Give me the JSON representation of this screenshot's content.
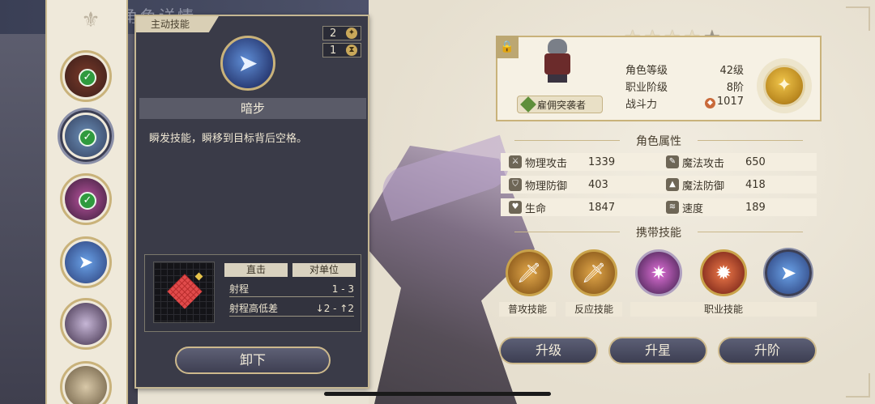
{
  "background": {
    "title_partial": "角色详情"
  },
  "skill_panel": {
    "tag": "主动技能",
    "cost_ap": "2",
    "cost_cd": "1",
    "skill_name": "暗步",
    "description": "瞬发技能，瞬移到目标背后空格。",
    "table": {
      "headers": [
        "直击",
        "对单位"
      ],
      "rows": [
        {
          "label": "射程",
          "value": "1 - 3"
        },
        {
          "label": "射程高低差",
          "value": "↓2 - ↑2"
        }
      ]
    },
    "unequip_label": "卸下"
  },
  "character": {
    "job": "雇佣突袭者",
    "stars_filled": 4,
    "stars_total": 5,
    "stats": [
      {
        "label": "角色等级",
        "value": "42级"
      },
      {
        "label": "职业阶级",
        "value": "8阶"
      },
      {
        "label": "战斗力",
        "value": "1017"
      }
    ]
  },
  "attributes": {
    "title": "角色属性",
    "items": [
      {
        "label": "物理攻击",
        "value": "1339",
        "icon": "sword-icon"
      },
      {
        "label": "魔法攻击",
        "value": "650",
        "icon": "staff-icon"
      },
      {
        "label": "物理防御",
        "value": "403",
        "icon": "shield-icon"
      },
      {
        "label": "魔法防御",
        "value": "418",
        "icon": "hat-icon"
      },
      {
        "label": "生命",
        "value": "1847",
        "icon": "heart-icon"
      },
      {
        "label": "速度",
        "value": "189",
        "icon": "wing-icon"
      }
    ]
  },
  "carried_skills": {
    "title": "携带技能",
    "labels": [
      "普攻技能",
      "反应技能",
      "职业技能"
    ]
  },
  "actions": {
    "upgrade": "升级",
    "star_up": "升星",
    "rank_up": "升阶"
  },
  "colors": {
    "panel_bg": "#3a3b48",
    "gold_border": "#c9b27a",
    "button_bg": "#3e3f52",
    "check_green": "#2f9a3e"
  }
}
